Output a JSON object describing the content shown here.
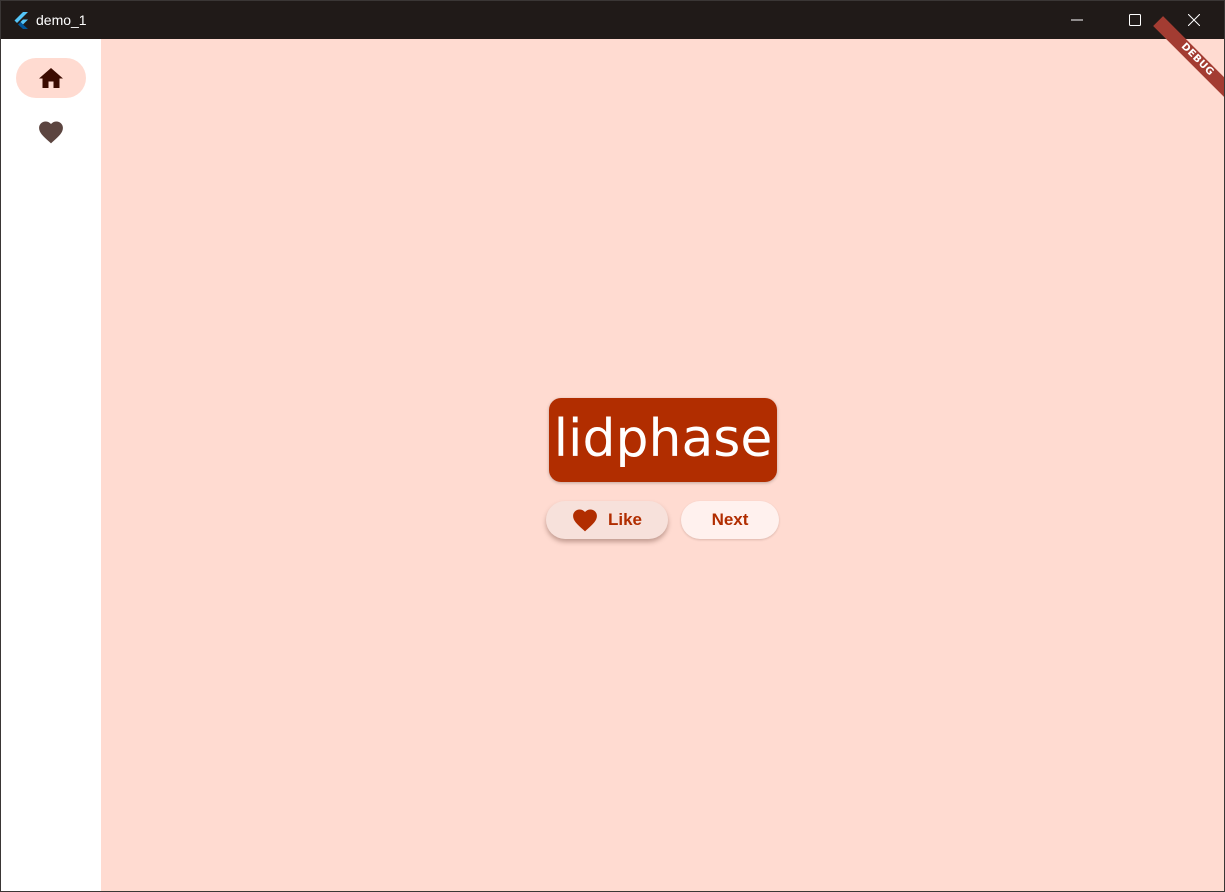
{
  "window": {
    "title": "demo_1"
  },
  "rail": {
    "items": [
      {
        "name": "home",
        "icon": "home-icon",
        "selected": true
      },
      {
        "name": "favorites",
        "icon": "heart-icon",
        "selected": false
      }
    ]
  },
  "debug_banner": "DEBUG",
  "main": {
    "word": "lidphase",
    "like_label": "Like",
    "next_label": "Next"
  },
  "colors": {
    "background": "#ffdbd1",
    "primary": "#b12d00",
    "titlebar": "#201a18",
    "rail_selected": "#ffdbd1"
  }
}
